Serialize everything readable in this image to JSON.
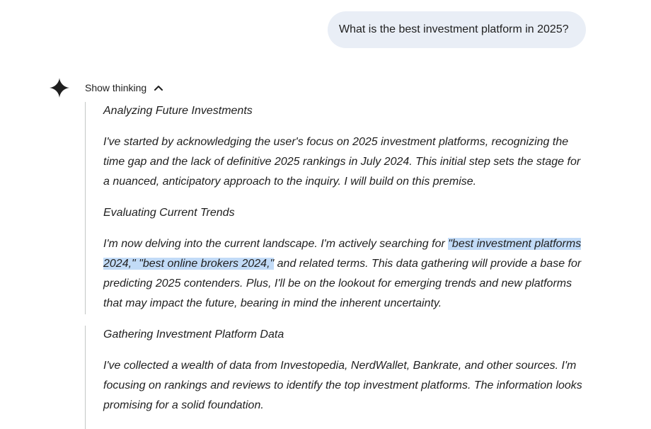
{
  "user_message": "What is the best investment platform in 2025?",
  "icons": {
    "assistant_logo": "sparkle-icon",
    "collapse": "chevron-up-icon"
  },
  "thinking": {
    "toggle_label": "Show thinking",
    "sections": [
      {
        "heading": "Analyzing Future Investments",
        "body": "I've started by acknowledging the user's focus on 2025 investment platforms, recognizing the time gap and the lack of definitive 2025 rankings in July 2024. This initial step sets the stage for a nuanced, anticipatory approach to the inquiry. I will build on this premise."
      },
      {
        "heading": "Evaluating Current Trends",
        "body_before": "I'm now delving into the current landscape. I'm actively searching for ",
        "body_highlight": "\"best investment platforms 2024,\" \"best online brokers 2024,\"",
        "body_after": " and related terms. This data gathering will provide a base for predicting 2025 contenders. Plus, I'll be on the lookout for emerging trends and new platforms that may impact the future, bearing in mind the inherent uncertainty."
      },
      {
        "heading": "Gathering Investment Platform Data",
        "body": "I've collected a wealth of data from Investopedia, NerdWallet, Bankrate, and other sources. I'm focusing on rankings and reviews to identify the top investment platforms. The information looks promising for a solid foundation."
      }
    ]
  },
  "colors": {
    "bubble_bg": "#e9eef6",
    "highlight": "#c2dbf7",
    "text": "#1f1f1f",
    "rule": "#c4c7c5"
  }
}
